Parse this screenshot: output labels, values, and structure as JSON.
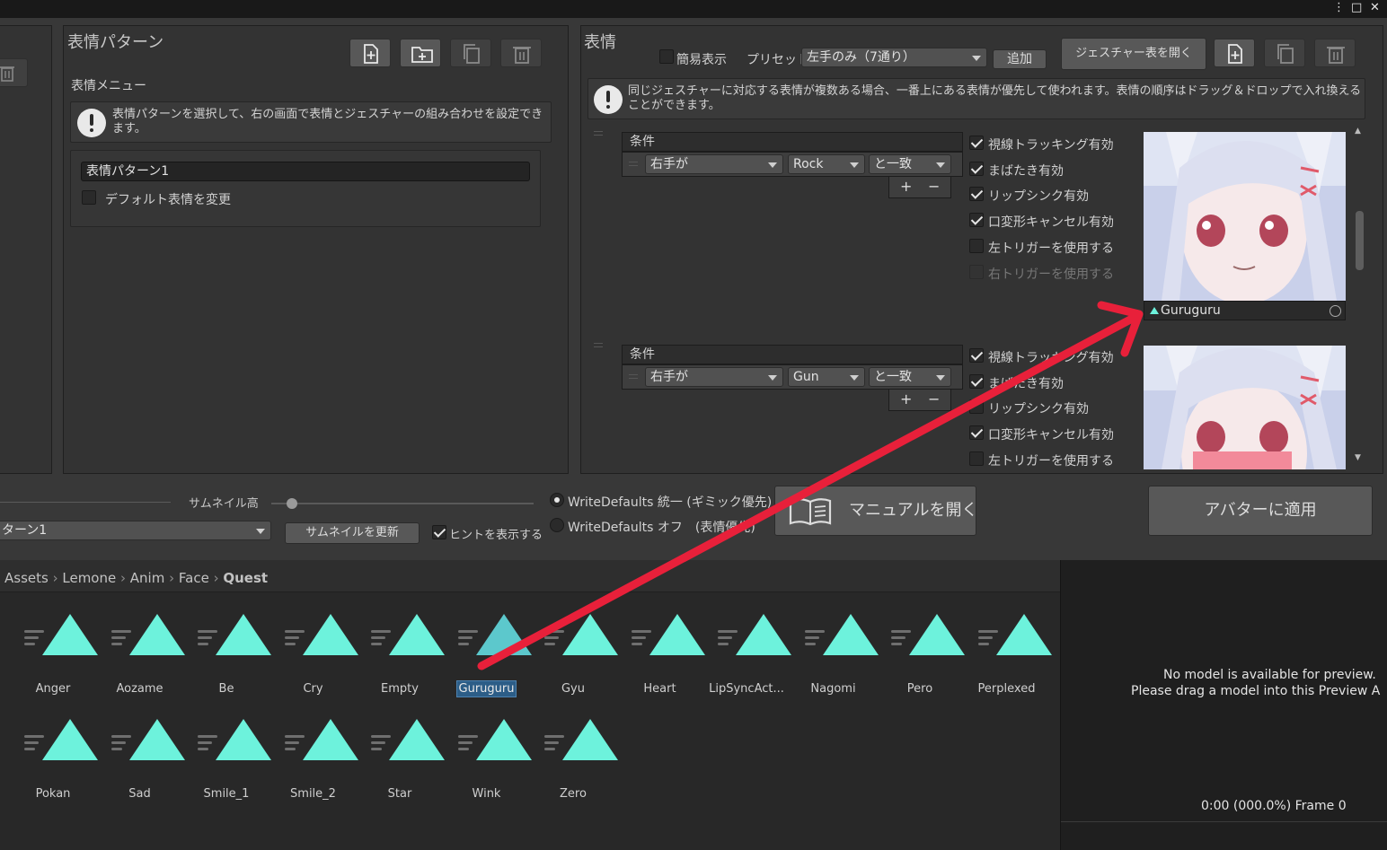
{
  "window": {
    "controls": [
      "⋮",
      "□",
      "✕"
    ]
  },
  "left_panel": {
    "title": "表情パターン",
    "menu_label": "表情メニュー",
    "help_text": "表情パターンを選択して、右の画面で表情とジェスチャーの組み合わせを設定できます。",
    "pattern_name": "表情パターン1",
    "default_change_label": "デフォルト表情を変更",
    "default_change_checked": false
  },
  "right_panel": {
    "title": "表情",
    "simple_label": "簡易表示",
    "preset_label": "プリセット",
    "preset_value": "左手のみ（7通り）",
    "add_label": "追加",
    "open_table_label": "ジェスチャー表を開く",
    "help_text": "同じジェスチャーに対応する表情が複数ある場合、一番上にある表情が優先して使われます。表情の順序はドラッグ＆ドロップで入れ換えることができます。",
    "entries": [
      {
        "condition_header": "条件",
        "hand": "右手が",
        "gesture": "Rock",
        "match": "と一致",
        "plus": "+",
        "minus": "−",
        "options": [
          {
            "label": "視線トラッキング有効",
            "checked": true,
            "disabled": false
          },
          {
            "label": "まばたき有効",
            "checked": true,
            "disabled": false
          },
          {
            "label": "リップシンク有効",
            "checked": true,
            "disabled": false
          },
          {
            "label": "口変形キャンセル有効",
            "checked": true,
            "disabled": false
          },
          {
            "label": "左トリガーを使用する",
            "checked": false,
            "disabled": false
          },
          {
            "label": "右トリガーを使用する",
            "checked": false,
            "disabled": true
          }
        ],
        "clip_name": "Guruguru"
      },
      {
        "condition_header": "条件",
        "hand": "右手が",
        "gesture": "Gun",
        "match": "と一致",
        "plus": "+",
        "minus": "−",
        "options": [
          {
            "label": "視線トラッキング有効",
            "checked": true,
            "disabled": false
          },
          {
            "label": "まばたき有効",
            "checked": true,
            "disabled": false
          },
          {
            "label": "リップシンク有効",
            "checked": false,
            "disabled": false
          },
          {
            "label": "口変形キャンセル有効",
            "checked": true,
            "disabled": false
          },
          {
            "label": "左トリガーを使用する",
            "checked": false,
            "disabled": false
          }
        ]
      }
    ]
  },
  "bottom_bar": {
    "thumb_height_label": "サムネイル高",
    "thumb_slider_value": 0.08,
    "pattern_select": "ターン1",
    "update_thumb_label": "サムネイルを更新",
    "show_hint_label": "ヒントを表示する",
    "show_hint_checked": true,
    "wd_on_label": "WriteDefaults 統一 (ギミック優先)",
    "wd_off_label": "WriteDefaults オフ　(表情優先)",
    "manual_label": "マニュアルを開く",
    "apply_label": "アバターに適用"
  },
  "project": {
    "breadcrumb": [
      "Assets",
      "Lemone",
      "Anim",
      "Face",
      "Quest"
    ],
    "assets": [
      "Anger",
      "Aozame",
      "Be",
      "Cry",
      "Empty",
      "Guruguru",
      "Gyu",
      "Heart",
      "LipSyncAct...",
      "Nagomi",
      "Pero",
      "Perplexed",
      "Pokan",
      "Sad",
      "Smile_1",
      "Smile_2",
      "Star",
      "Wink",
      "Zero"
    ],
    "selected_asset": "Guruguru",
    "asset_color": "#6df2dc"
  },
  "preview": {
    "message_line1": "No model is available for preview.",
    "message_line2": "Please drag a model into this Preview A",
    "time": "0:00 (000.0%) Frame 0"
  },
  "annotation": {
    "arrow_color": "#e8203a"
  }
}
